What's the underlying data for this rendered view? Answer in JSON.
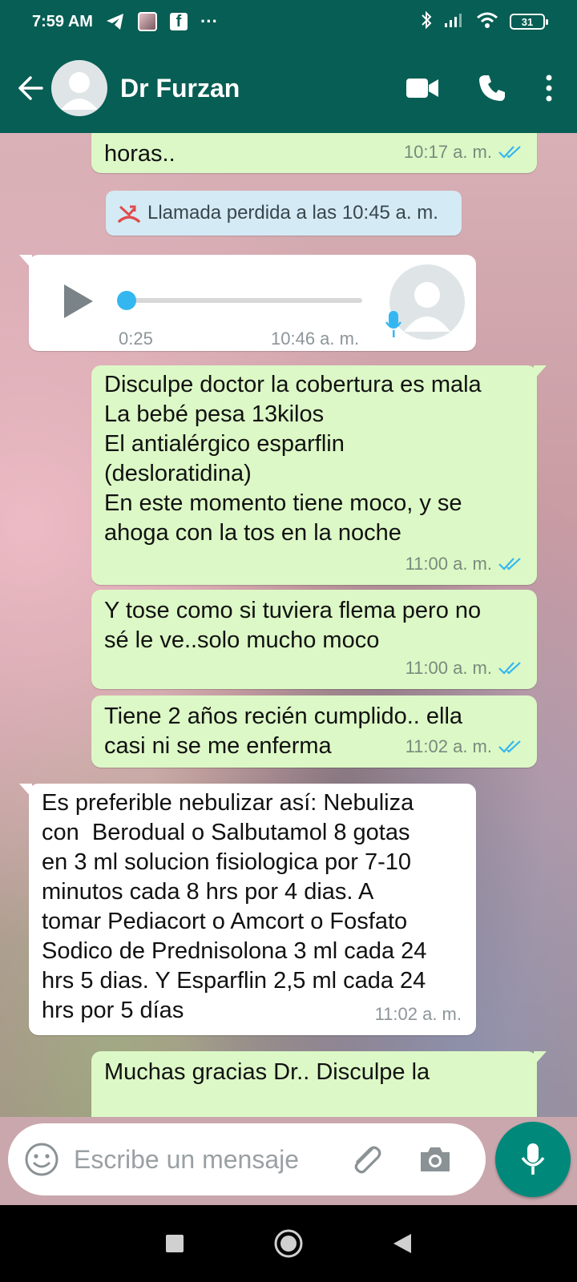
{
  "status_bar": {
    "time": "7:59 AM",
    "battery": "31",
    "more": "···"
  },
  "header": {
    "contact_name": "Dr Furzan"
  },
  "messages": {
    "m1": {
      "text": "horas..",
      "time": "10:17 a. m."
    },
    "missed_call": {
      "text": "Llamada perdida a las 10:45 a. m."
    },
    "voice": {
      "duration": "0:25",
      "time": "10:46 a. m.",
      "progress": 0
    },
    "m3": {
      "text": "Disculpe doctor la cobertura es mala\nLa bebé pesa 13kilos\nEl antialérgico esparflin\n(desloratidina)\nEn este momento tiene moco, y se\nahoga con la tos en la noche",
      "time": "11:00 a. m."
    },
    "m4": {
      "text": "Y tose como si tuviera flema pero no\nsé le ve..solo mucho moco",
      "time": "11:00 a. m."
    },
    "m5": {
      "text": "Tiene 2 años recién cumplido.. ella\ncasi ni se me enferma",
      "time": "11:02 a. m."
    },
    "m6": {
      "text": "Es preferible nebulizar así: Nebuliza\ncon  Berodual o Salbutamol 8 gotas\nen 3 ml solucion fisiologica por 7-10\nminutos cada 8 hrs por 4 dias. A\ntomar Pediacort o Amcort o Fosfato\nSodico de Prednisolona 3 ml cada 24\nhrs 5 dias. Y Esparflin 2,5 ml cada 24\nhrs por 5 días",
      "time": "11:02 a. m."
    },
    "m7": {
      "text": "Muchas gracias Dr.. Disculpe la"
    }
  },
  "input": {
    "placeholder": "Escribe un mensaje"
  },
  "colors": {
    "header": "#075e54",
    "outgoing": "#dcf8c6",
    "incoming": "#ffffff",
    "read_ticks": "#34b7f1",
    "fab": "#00897b"
  }
}
